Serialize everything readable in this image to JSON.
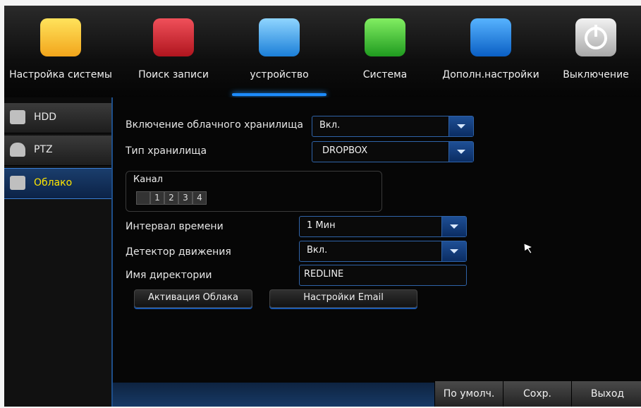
{
  "top_tabs": [
    {
      "label": "Настройка системы",
      "icon": "settings-gears-icon"
    },
    {
      "label": "Поиск записи",
      "icon": "video-search-icon"
    },
    {
      "label": "устройство",
      "icon": "cloud-storage-icon",
      "active": true
    },
    {
      "label": "Система",
      "icon": "calendar-info-icon"
    },
    {
      "label": "Дополн.настройки",
      "icon": "advanced-settings-email-icon"
    },
    {
      "label": "Выключение",
      "icon": "power-icon"
    }
  ],
  "sidebar": {
    "items": [
      {
        "label": "HDD",
        "icon": "hdd-icon"
      },
      {
        "label": "PTZ",
        "icon": "ptz-camera-icon"
      },
      {
        "label": "Облако",
        "icon": "cloud-icon",
        "selected": true
      }
    ]
  },
  "form": {
    "cloud_enable": {
      "label": "Включение облачного хранилища",
      "value": "Вкл."
    },
    "storage_type": {
      "label": "Тип хранилища",
      "value": "DROPBOX"
    },
    "channel": {
      "label": "Канал",
      "options": [
        "1",
        "2",
        "3",
        "4"
      ]
    },
    "interval": {
      "label": "Интервал времени",
      "value": "1 Мин"
    },
    "motion": {
      "label": "Детектор движения",
      "value": "Вкл."
    },
    "directory": {
      "label": "Имя директории",
      "value": "REDLINE"
    },
    "activate_button": "Активация Облака",
    "email_button": "Настройки Email"
  },
  "footer": {
    "default_label": "По умолч.",
    "save_label": "Сохр.",
    "exit_label": "Выход"
  },
  "colors": {
    "accent": "#1d8cff",
    "selected_text": "#ffe600",
    "panel_bg": "#060606"
  }
}
